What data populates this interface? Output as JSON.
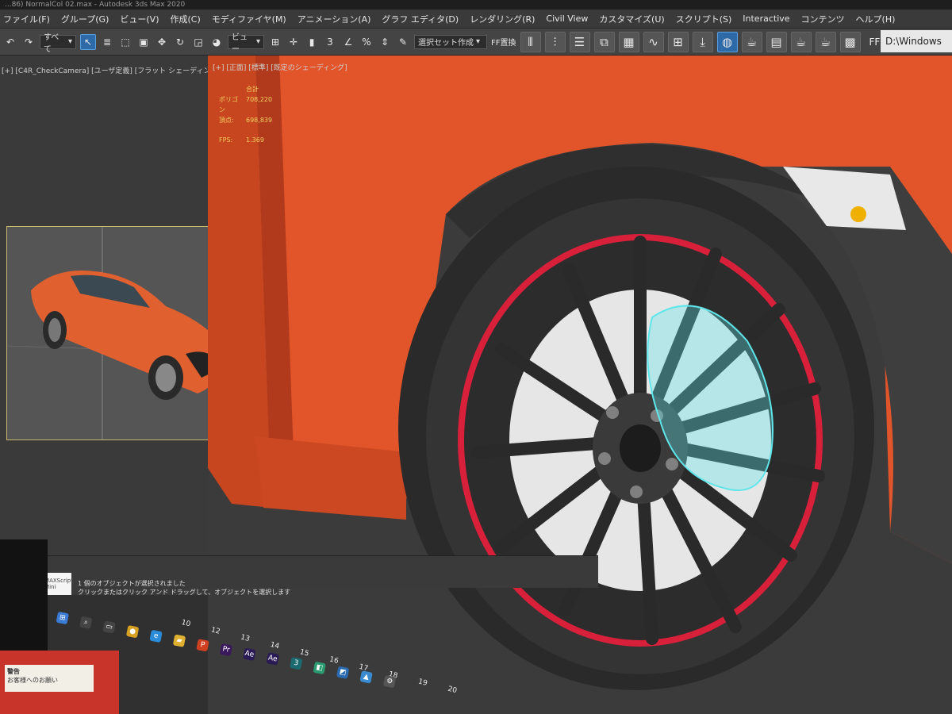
{
  "window": {
    "title": "...86) NormalCol 02.max - Autodesk 3ds Max 2020"
  },
  "menu": {
    "items": [
      "ファイル(F)",
      "グループ(G)",
      "ビュー(V)",
      "作成(C)",
      "モディファイヤ(M)",
      "アニメーション(A)",
      "グラフ エディタ(D)",
      "レンダリング(R)",
      "Civil View",
      "カスタマイズ(U)",
      "スクリプト(S)",
      "Interactive",
      "コンテンツ",
      "ヘルプ(H)"
    ]
  },
  "toolbar": {
    "filter_value": "すべて",
    "view_value": "ビュー",
    "selection_set_placeholder": "選択セット作成",
    "ff_label": "FF置換",
    "ffpcm_label": "FFPCM"
  },
  "path_box": {
    "value": "D:\\Windows"
  },
  "viewports": {
    "left_label": "[+] [C4R_CheckCamera] [ユーザ定義] [フラット シェーディング]",
    "main_label": "[+] [正面] [標準] [既定のシェーディング]"
  },
  "stats": {
    "header": "合計",
    "polygons_label": "ポリゴン",
    "polygons_value": "708,220",
    "vertices_label": "頂点:",
    "vertices_value": "698,839",
    "fps_label": "FPS:",
    "fps_value": "1.369"
  },
  "status": {
    "track_button": "MAXScript Mini",
    "line1": "1 個のオブジェクトが選択されました",
    "line2": "クリックまたはクリック アンド ドラッグして、オブジェクトを選択します"
  },
  "timeline": {
    "frames": [
      "10",
      "12",
      "13",
      "14",
      "15",
      "16",
      "17",
      "18",
      "19",
      "20"
    ]
  },
  "sticker": {
    "heading": "警告",
    "text": "お客様へのお願い"
  },
  "colors": {
    "car_body": "#e2542a",
    "car_shadow": "#b23a1c",
    "tire": "#2a2a2a",
    "rim_stripe": "#d8203a",
    "caliper_selection": "#5fe6ea",
    "accent_blue": "#2e6aa8"
  }
}
